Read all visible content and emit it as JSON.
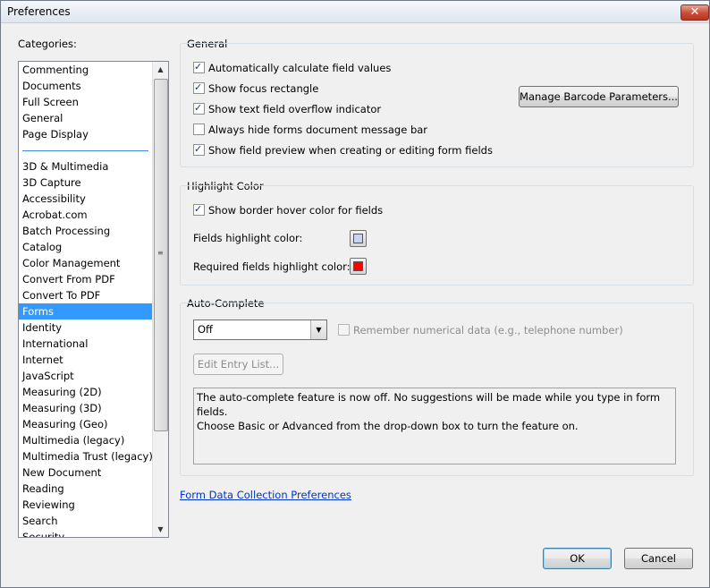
{
  "window": {
    "title": "Preferences",
    "close_glyph": "✕"
  },
  "categories": {
    "label": "Categories:",
    "top_items": [
      "Commenting",
      "Documents",
      "Full Screen",
      "General",
      "Page Display"
    ],
    "items": [
      "3D & Multimedia",
      "3D Capture",
      "Accessibility",
      "Acrobat.com",
      "Batch Processing",
      "Catalog",
      "Color Management",
      "Convert From PDF",
      "Convert To PDF",
      "Forms",
      "Identity",
      "International",
      "Internet",
      "JavaScript",
      "Measuring (2D)",
      "Measuring (3D)",
      "Measuring (Geo)",
      "Multimedia (legacy)",
      "Multimedia Trust (legacy)",
      "New Document",
      "Reading",
      "Reviewing",
      "Search",
      "Security"
    ],
    "selected": "Forms"
  },
  "general": {
    "title": "General",
    "auto_calc": {
      "label": "Automatically calculate field values",
      "checked": true
    },
    "focus_rect": {
      "label": "Show focus rectangle",
      "checked": true
    },
    "overflow": {
      "label": "Show text field overflow indicator",
      "checked": true
    },
    "hide_bar": {
      "label": "Always hide forms document message bar",
      "checked": false
    },
    "preview": {
      "label": "Show field preview when creating or editing form fields",
      "checked": true
    },
    "barcode_button": "Manage Barcode Parameters..."
  },
  "highlight": {
    "title": "Highlight Color",
    "hover": {
      "label": "Show border hover color for fields",
      "checked": true
    },
    "fields_label": "Fields highlight color:",
    "fields_color": "#c8d4f0",
    "required_label": "Required fields highlight color:",
    "required_color": "#ff0000"
  },
  "autocomplete": {
    "title": "Auto-Complete",
    "mode": "Off",
    "remember": {
      "label": "Remember numerical data (e.g., telephone number)",
      "checked": false
    },
    "edit_button": "Edit Entry List...",
    "description_line1": "The auto-complete feature is now off. No suggestions will be made while you type in form fields.",
    "description_line2": "Choose Basic or Advanced from the drop-down box to turn the feature on."
  },
  "link": "Form Data Collection Preferences",
  "footer": {
    "ok": "OK",
    "cancel": "Cancel"
  }
}
